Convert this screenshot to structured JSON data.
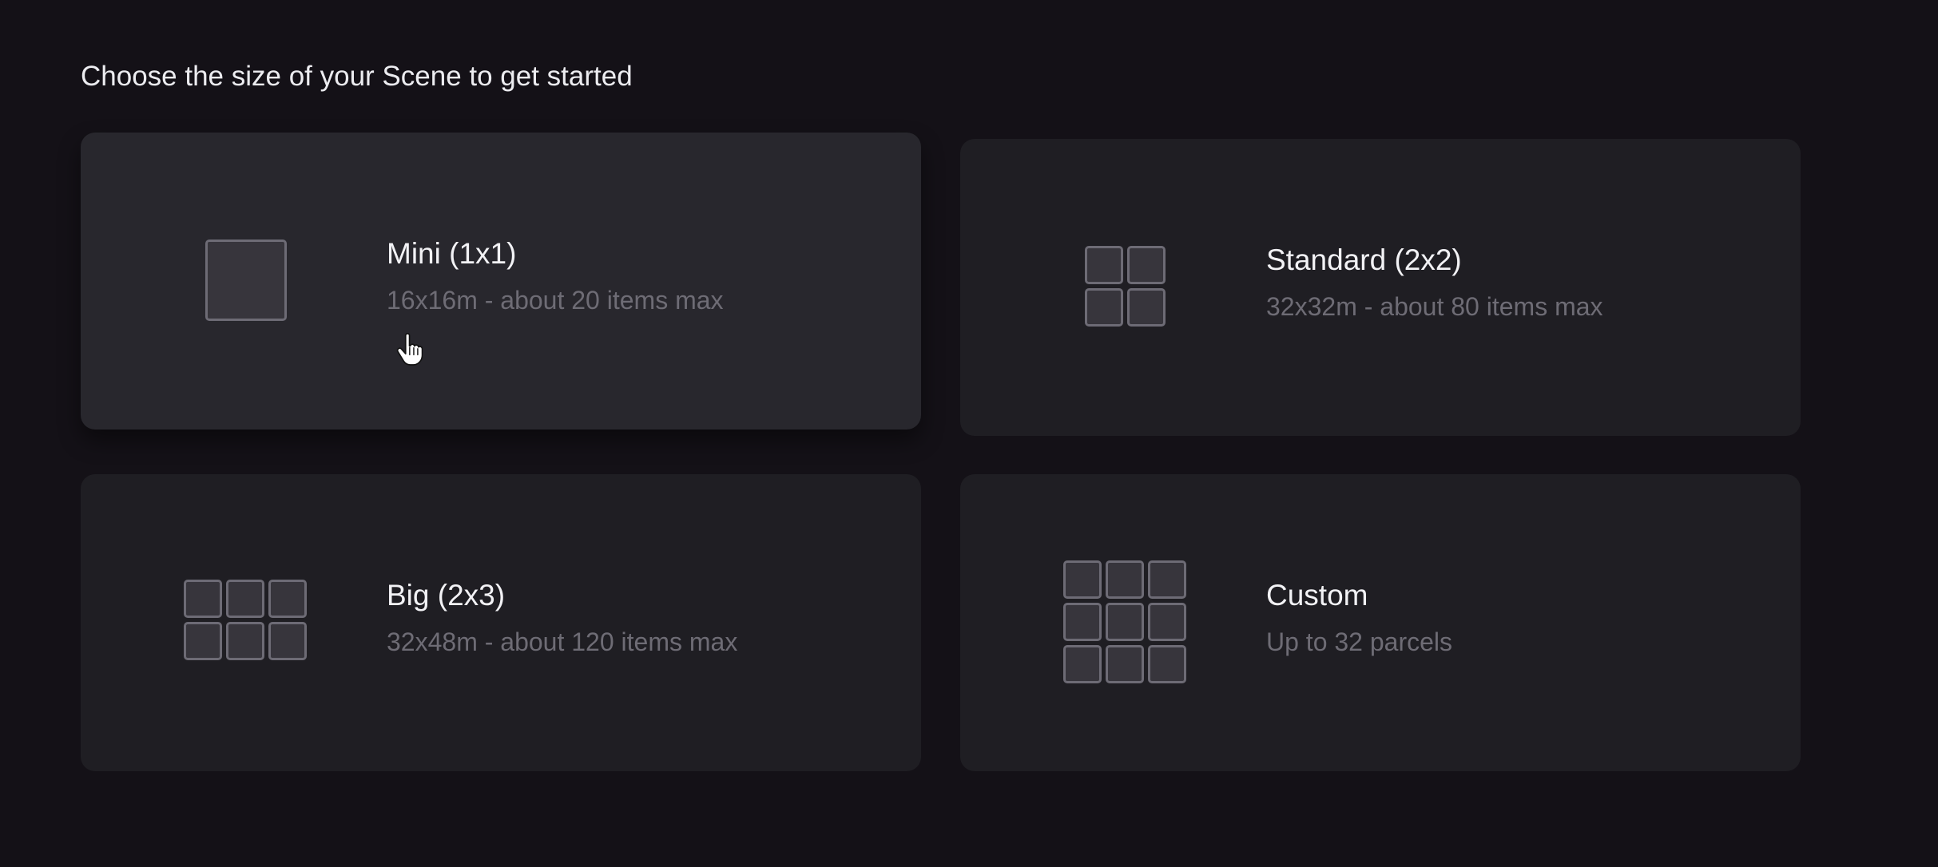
{
  "heading": "Choose the size of your Scene to get started",
  "cards": [
    {
      "title": "Mini (1x1)",
      "description": "16x16m - about 20 items max",
      "icon": "single-parcel-icon"
    },
    {
      "title": "Standard (2x2)",
      "description": "32x32m - about 80 items max",
      "icon": "grid-2x2-icon"
    },
    {
      "title": "Big (2x3)",
      "description": "32x48m - about 120 items max",
      "icon": "grid-3x2-icon"
    },
    {
      "title": "Custom",
      "description": "Up to 32 parcels",
      "icon": "grid-3x3-icon"
    }
  ],
  "colors": {
    "background": "#141117",
    "card": "#1f1e23",
    "card_hover": "#28272d",
    "title_text": "#f2f2f5",
    "secondary_text": "#6e6c75",
    "icon_stroke": "#6d6b75"
  },
  "cursor": "pointer-hand-icon"
}
